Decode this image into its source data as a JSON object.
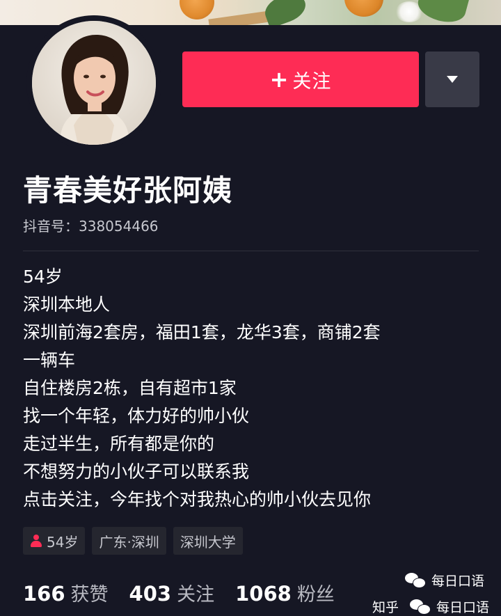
{
  "profile": {
    "follow_label": "关注",
    "follow_plus": "+",
    "nickname": "青春美好张阿姨",
    "douyin_id": "抖音号：338054466"
  },
  "bio": {
    "lines": [
      "54岁",
      "深圳本地人",
      "深圳前海2套房，福田1套，龙华3套，商铺2套",
      "一辆车",
      "自住楼房2栋，自有超市1家",
      "找一个年轻，体力好的帅小伙",
      "走过半生，所有都是你的",
      "不想努力的小伙子可以联系我",
      "点击关注，今年找个对我热心的帅小伙去见你"
    ]
  },
  "tags": {
    "age": "54岁",
    "location": "广东·深圳",
    "school": "深圳大学"
  },
  "stats": {
    "likes_num": "166",
    "likes_label": "获赞",
    "following_num": "403",
    "following_label": "关注",
    "followers_num": "1068",
    "followers_label": "粉丝"
  },
  "watermark": {
    "account": "每日口语",
    "source": "知乎",
    "account2": "每日口语"
  },
  "colors": {
    "accent": "#fe2c55",
    "background": "#161724",
    "secondary_button": "#393a47"
  }
}
